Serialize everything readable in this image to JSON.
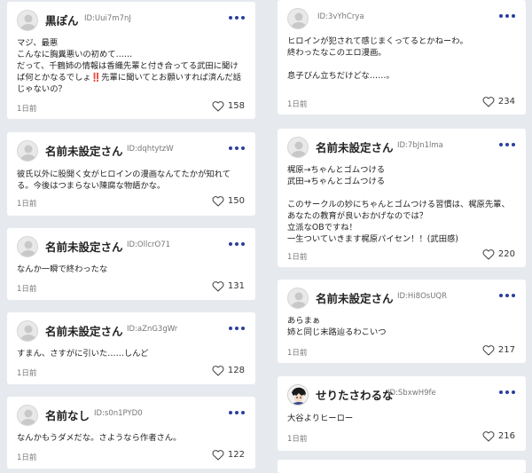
{
  "left_column": [
    {
      "name": "黒ぽん",
      "id": "ID:Uui7m7nJ",
      "lines": [
        "マジ、最悪",
        "こんなに胸糞悪いの初めて……",
        "だって、千鶴姉の情報は香織先輩と付き合ってる武田に聞け",
        "ば何とかなるでしょ‼️先輩に聞いてとお願いすれば済んだ話",
        "じゃないの？"
      ],
      "time": "1日前",
      "likes": "158"
    },
    {
      "name": "名前未設定さん",
      "id": "ID:dqhtytzW",
      "lines": [
        "彼氏以外に股開く女がヒロインの漫画なんてたかが知れて",
        "る。今後はつまらない陳腐な物語かな。"
      ],
      "time": "1日前",
      "likes": "150"
    },
    {
      "name": "名前未設定さん",
      "id": "ID:OllcrO71",
      "lines": [
        "なんか一瞬で終わったな"
      ],
      "time": "1日前",
      "likes": "131"
    },
    {
      "name": "名前未設定さん",
      "id": "ID:aZnG3gWr",
      "lines": [
        "すまん、さすがに引いた……しんど"
      ],
      "time": "1日前",
      "likes": "128"
    },
    {
      "name": "名前なし",
      "id": "ID:s0n1PYD0",
      "lines": [
        "なんかもうダメだな。さようなら作者さん。"
      ],
      "time": "1日前",
      "likes": "122"
    }
  ],
  "right_column": [
    {
      "name": "",
      "id": "ID:3vYhCrya",
      "lines": [
        "ヒロインが犯されて感じまくってるとかねーわ。",
        "終わったなこのエロ漫画。",
        "",
        "息子びん立ちだけどな……。"
      ],
      "time": "1日前",
      "likes": "234"
    },
    {
      "name": "名前未設定さん",
      "id": "ID:7bJn1lma",
      "lines": [
        "梶原→ちゃんとゴムつける",
        "武田→ちゃんとゴムつける",
        "",
        "このサークルの妙にちゃんとゴムつける習慣は、梶原先輩、",
        "あなたの教育が良いおかげなのでは？",
        "立派なOBですね！",
        "一生ついていきます梶原パイセン！！(武田感)"
      ],
      "time": "1日前",
      "likes": "220"
    },
    {
      "name": "名前未設定さん",
      "id": "ID:Hi8OsUQR",
      "lines": [
        "あらまぁ",
        "姉と同じ末路辿るわこいつ"
      ],
      "time": "1日前",
      "likes": "217"
    },
    {
      "name": "せりたさわるな",
      "id": "ID:SbxwH9fe",
      "lines": [
        "大谷よりヒーロー"
      ],
      "time": "1日前",
      "likes": "216"
    }
  ],
  "colors": {
    "accent": "#2a3f9e",
    "background": "#e6eaef",
    "card": "#ffffff"
  },
  "icons": {
    "menu": "more-dots-icon",
    "like": "heart-outline-icon",
    "avatar": "default-user-icon"
  }
}
